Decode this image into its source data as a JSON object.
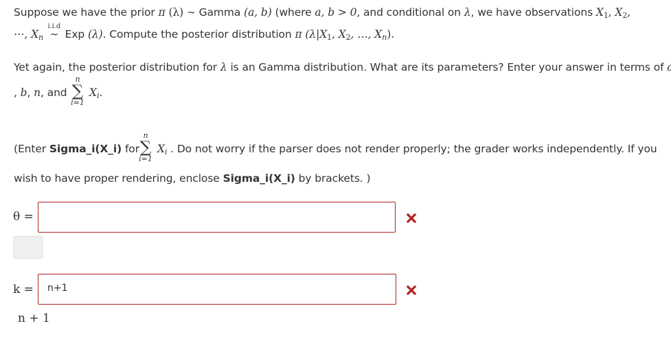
{
  "problem": {
    "line1": {
      "t1": "Suppose we have the prior ",
      "pi1": "π",
      "lam1": " (λ) ∼ ",
      "gamma": "Gamma ",
      "ab": "(a, b)",
      "t2": " (where ",
      "cond": "a, b > 0",
      "t3": ", and conditional on ",
      "lam2": "λ",
      "t4": ", we have observations ",
      "x1": "X",
      "x1s": "1",
      "comma1": ", ",
      "x2": "X",
      "x2s": "2",
      "comma2": ","
    },
    "line2": {
      "dots": "⋯, ",
      "xn": "X",
      "xns": "n",
      "iid": "i.i.d",
      "tilde": "∼",
      "exp": " Exp ",
      "explam": "(λ)",
      "t1": ". Compute the posterior distribution ",
      "post": "π (λ|X",
      "ps1": "1",
      "p2": ", X",
      "ps2": "2",
      "p3": ", …, X",
      "psn": "n",
      "p4": ").",
      "t2": ""
    },
    "line3": {
      "t1": "Yet again, the posterior distribution for ",
      "lam": "λ",
      "t2": " is an Gamma distribution. What are its parameters? Enter your answer in terms of ",
      "a": "a"
    },
    "line4": {
      "t1": ", ",
      "b": "b",
      "t2": ", ",
      "n": "n",
      "t3": ", and ",
      "sum_top": "n",
      "sum_sig": "∑",
      "sum_bot": "i=1",
      "xi": "X",
      "xis": "i",
      "t4": "."
    },
    "note1": {
      "t1": "(Enter ",
      "bold": "Sigma_i(X_i)",
      "t2": " for ",
      "sum_top": "n",
      "sum_sig": "∑",
      "sum_bot": "i=1",
      "xi": "X",
      "xis": "i",
      "t3": " . Do not worry if the parser does not render properly; the grader works independently. If you"
    },
    "note2": {
      "t1": "wish to have proper rendering, enclose ",
      "bold": "Sigma_i(X_i)",
      "t2": " by brackets. )"
    }
  },
  "answers": {
    "theta": {
      "label": "θ =",
      "value": "",
      "preview": ""
    },
    "k": {
      "label": "k =",
      "value": "n+1",
      "preview": "n + 1"
    }
  },
  "colors": {
    "error": "#b22222",
    "text": "#333333"
  },
  "icons": {
    "incorrect": "x-mark-icon"
  }
}
